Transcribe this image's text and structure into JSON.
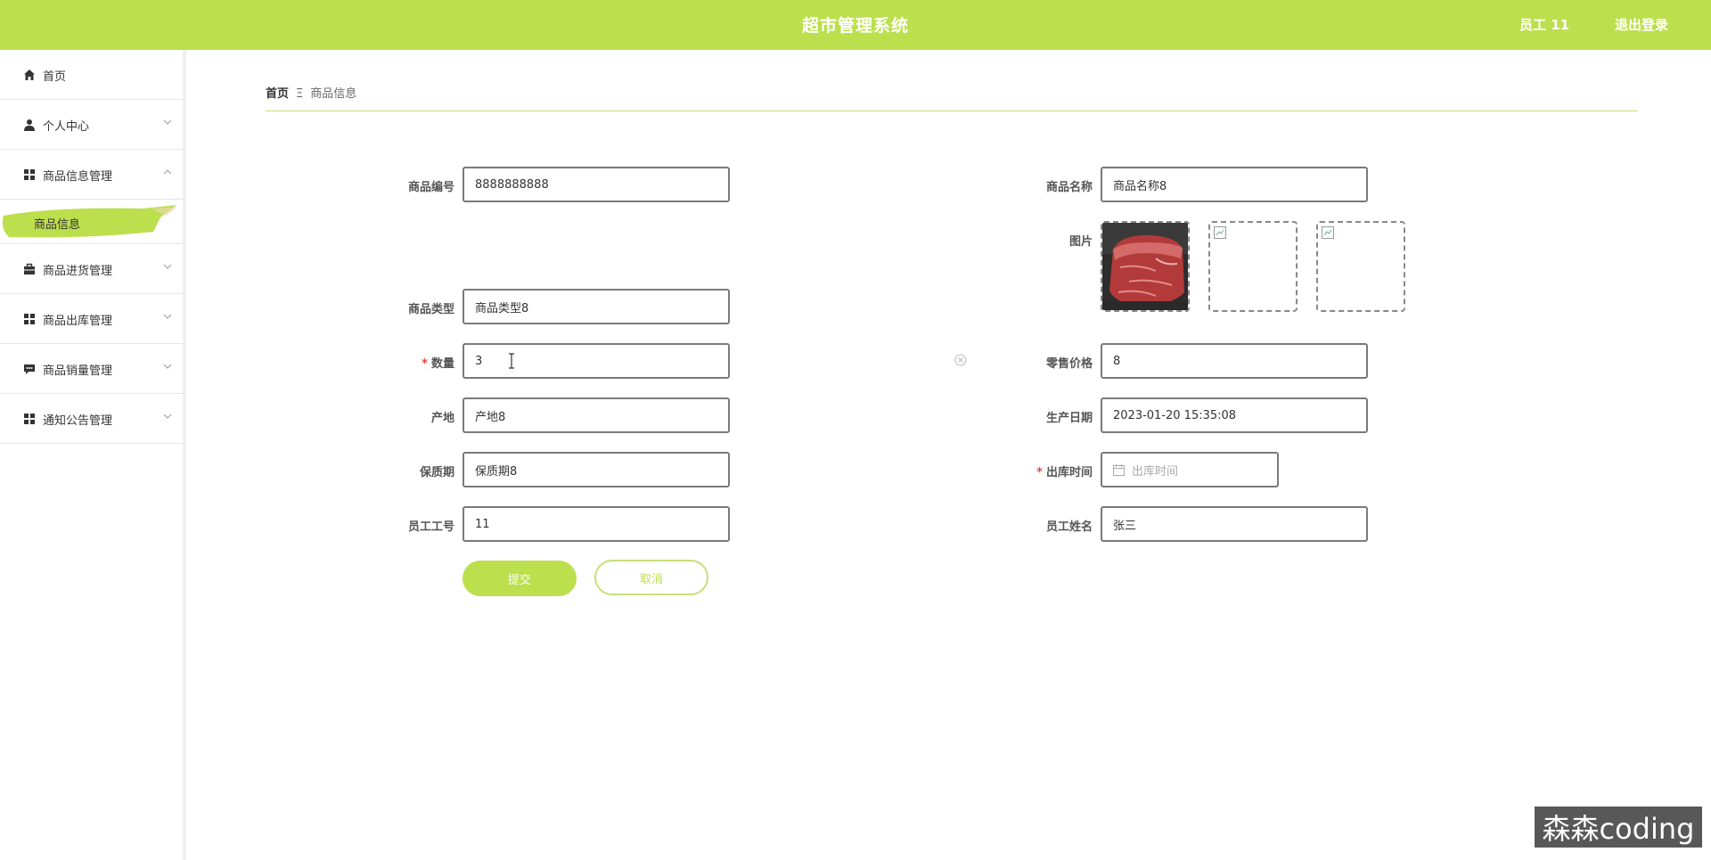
{
  "header": {
    "title": "超市管理系统",
    "user": "员工 11",
    "logout": "退出登录"
  },
  "sidebar": {
    "items": [
      {
        "label": "首页",
        "icon": "home-icon"
      },
      {
        "label": "个人中心",
        "icon": "user-icon"
      },
      {
        "label": "商品信息管理",
        "icon": "grid-icon",
        "expanded": true,
        "children": [
          {
            "label": "商品信息"
          }
        ]
      },
      {
        "label": "商品进货管理",
        "icon": "briefcase-icon"
      },
      {
        "label": "商品出库管理",
        "icon": "grid-icon"
      },
      {
        "label": "商品销量管理",
        "icon": "chat-icon"
      },
      {
        "label": "通知公告管理",
        "icon": "grid-icon"
      }
    ]
  },
  "breadcrumb": {
    "home": "首页",
    "separator": "Ξ",
    "current": "商品信息"
  },
  "form": {
    "goods_code": {
      "label": "商品编号",
      "value": "8888888888"
    },
    "goods_name": {
      "label": "商品名称",
      "value": "商品名称8"
    },
    "image": {
      "label": "图片"
    },
    "goods_type": {
      "label": "商品类型",
      "value": "商品类型8"
    },
    "quantity": {
      "label": "数量",
      "value": "3",
      "required": "*"
    },
    "retail_price": {
      "label": "零售价格",
      "value": "8"
    },
    "origin": {
      "label": "产地",
      "value": "产地8"
    },
    "production_date": {
      "label": "生产日期",
      "value": "2023-01-20 15:35:08"
    },
    "shelf_life": {
      "label": "保质期",
      "value": "保质期8"
    },
    "outbound_time": {
      "label": "出库时间",
      "placeholder": "出库时间",
      "required": "*"
    },
    "employee_no": {
      "label": "员工工号",
      "value": "11"
    },
    "employee_name": {
      "label": "员工姓名",
      "value": "张三"
    }
  },
  "buttons": {
    "submit": "提交",
    "cancel": "取消"
  },
  "watermark": "森森coding",
  "colors": {
    "accent": "#bcdf4d",
    "required": "#e54848"
  }
}
